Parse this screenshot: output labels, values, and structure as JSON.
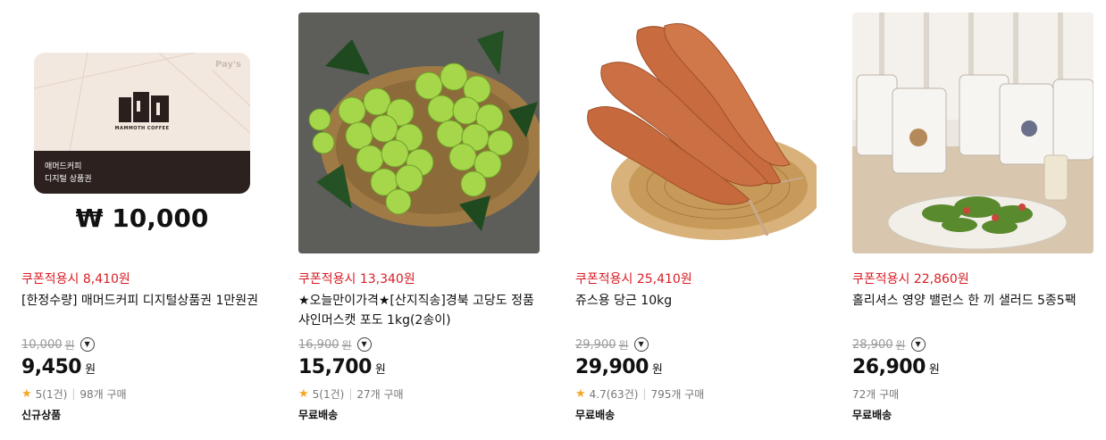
{
  "products": [
    {
      "coupon_text": "쿠폰적용시 8,410원",
      "title": "[한정수량] 매머드커피 디지털상품권 1만원권",
      "original_price": "10,000",
      "original_unit": "원",
      "price": "9,450",
      "unit": "원",
      "rating": "5(1건)",
      "purchases": "98개 구매",
      "tag": "신규상품",
      "image": {
        "card_title_line1": "매머드커피",
        "card_title_line2": "디지털 상품권",
        "logo_text": "MAMMOTH COFFEE",
        "pay_mark": "Pay's",
        "amount": "₩ 10,000"
      }
    },
    {
      "coupon_text": "쿠폰적용시 13,340원",
      "title": "★오늘만이가격★[산지직송]경북 고당도 정품 샤인머스캣 포도 1kg(2송이)",
      "original_price": "16,900",
      "original_unit": "원",
      "price": "15,700",
      "unit": "원",
      "rating": "5(1건)",
      "purchases": "27개 구매",
      "tag": "무료배송"
    },
    {
      "coupon_text": "쿠폰적용시 25,410원",
      "title": "쥬스용 당근 10kg",
      "original_price": "29,900",
      "original_unit": "원",
      "price": "29,900",
      "unit": "원",
      "rating": "4.7(63건)",
      "purchases": "795개 구매",
      "tag": "무료배송"
    },
    {
      "coupon_text": "쿠폰적용시 22,860원",
      "title": "홀리셔스 영양 밸런스 한 끼 샐러드 5종5팩",
      "original_price": "28,900",
      "original_unit": "원",
      "price": "26,900",
      "unit": "원",
      "purchases": "72개 구매",
      "tag": "무료배송"
    }
  ],
  "icons": {
    "dropdown": "chevron-down-icon",
    "star": "star-icon"
  },
  "colors": {
    "coupon": "#d81d25",
    "star": "#f5a623"
  }
}
